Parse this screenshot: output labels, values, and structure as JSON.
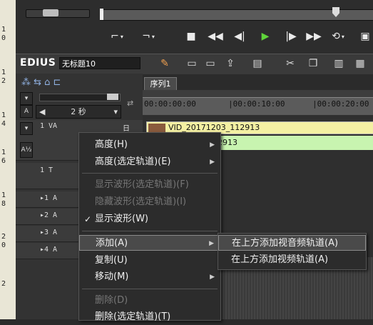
{
  "ruler_left": {
    "ticks": [
      "1",
      "0",
      "1",
      "2",
      "1",
      "4",
      "1",
      "6",
      "1",
      "8",
      "2",
      "0",
      "2"
    ]
  },
  "app": {
    "name": "EDIUS",
    "project_title": "无标题10"
  },
  "sequence": {
    "tab_label": "序列1"
  },
  "timecodes": [
    "00:00:00:00",
    "|00:00:10:00",
    "|00:00:20:00"
  ],
  "track_controls": {
    "zoom_label": "2 秒"
  },
  "tracks": [
    {
      "label": "1 VA",
      "mode": "日"
    },
    {
      "label": "1 T"
    },
    {
      "label": "▸1 A"
    },
    {
      "label": "▸2 A"
    },
    {
      "label": "▸3 A"
    },
    {
      "label": "▸4 A"
    }
  ],
  "clips": {
    "video_name": "VID_20171203_112913",
    "audio_name": "2913"
  },
  "context_menu": {
    "items": [
      {
        "label": "高度(H)",
        "submenu": true,
        "enabled": true
      },
      {
        "label": "高度(选定轨道)(E)",
        "submenu": true,
        "enabled": true
      },
      {
        "label": "显示波形(选定轨道)(F)",
        "enabled": false
      },
      {
        "label": "隐藏波形(选定轨道)(I)",
        "enabled": false
      },
      {
        "label": "显示波形(W)",
        "checked": true,
        "enabled": true
      },
      {
        "label": "添加(A)",
        "submenu": true,
        "enabled": true,
        "active": true
      },
      {
        "label": "复制(U)",
        "enabled": true
      },
      {
        "label": "移动(M)",
        "submenu": true,
        "enabled": true
      },
      {
        "label": "删除(D)",
        "enabled": false
      },
      {
        "label": "删除(选定轨道)(T)",
        "enabled": true
      }
    ],
    "submenu_items": [
      {
        "label": "在上方添加视音频轨道(A)",
        "active": true
      },
      {
        "label": "在上方添加视频轨道(A)"
      }
    ]
  },
  "colors": {
    "play_green": "#5fd43a",
    "clip_yellow": "#f4f0a3",
    "clip_green": "#c8f4b0"
  }
}
